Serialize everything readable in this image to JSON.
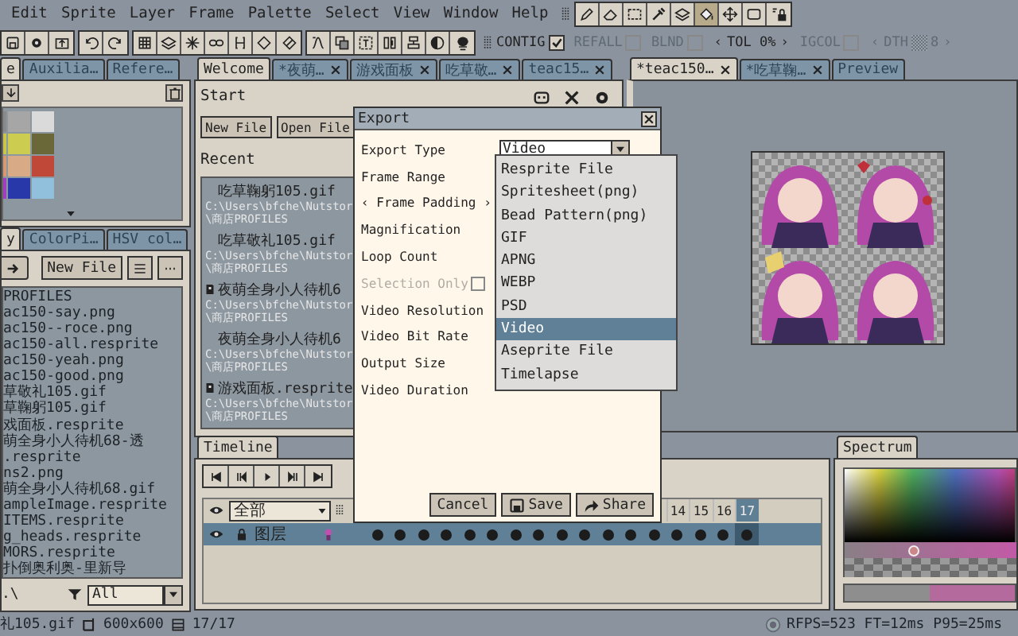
{
  "menu": [
    "Edit",
    "Sprite",
    "Layer",
    "Frame",
    "Palette",
    "Select",
    "View",
    "Window",
    "Help"
  ],
  "tools": [
    {
      "selected": false
    },
    {
      "selected": false
    },
    {
      "selected": false
    },
    {
      "selected": false
    },
    {
      "selected": false
    },
    {
      "selected": true
    },
    {
      "selected": false
    },
    {
      "selected": false
    },
    {
      "selected": false
    }
  ],
  "tool_options": [
    {
      "kind": "check",
      "label": "CONTIG",
      "checked": true,
      "disabled": false
    },
    {
      "kind": "check",
      "label": "REFALL",
      "checked": false,
      "disabled": true
    },
    {
      "kind": "check",
      "label": "BLND",
      "checked": false,
      "disabled": true
    },
    {
      "kind": "stepper",
      "left": "‹",
      "label": "TOL 0%",
      "right": "›",
      "disabled": false
    },
    {
      "kind": "check",
      "label": "IGCOL",
      "checked": false,
      "disabled": true
    },
    {
      "kind": "dither",
      "left": "‹",
      "label": "DTH",
      "value": "8",
      "right": "›",
      "disabled": true
    }
  ],
  "left_top_tabs": [
    {
      "label": "e",
      "selected": true
    },
    {
      "label": "Auxilia…",
      "selected": false
    },
    {
      "label": "Refere…",
      "selected": false
    }
  ],
  "palette": [
    {
      "color": "#8a8a8a"
    },
    {
      "color": "#a6a6a6"
    },
    {
      "color": "#dadada"
    },
    {
      "color": "#c8c848"
    },
    {
      "color": "#cccc50"
    },
    {
      "color": "#6a6838"
    },
    {
      "color": "#d89870"
    },
    {
      "color": "#d8aa86"
    },
    {
      "color": "#c04838"
    },
    {
      "color": "#a040c0"
    },
    {
      "color": "#2838a8"
    },
    {
      "color": "#90c0dc"
    }
  ],
  "left_bottom_tabs": [
    {
      "label": "y",
      "selected": true
    },
    {
      "label": "ColorPi…",
      "selected": false
    },
    {
      "label": "HSV col…",
      "selected": false
    }
  ],
  "files": {
    "new_button": "New File",
    "items": [
      "PROFILES",
      "ac150-say.png",
      "ac150--roce.png",
      "ac150-all.resprite",
      "ac150-yeah.png",
      "ac150-good.png",
      "草敬礼105.gif",
      "草鞠躬105.gif",
      "戏面板.resprite",
      "萌全身小人待机68-透",
      ".resprite",
      "ns2.png",
      "萌全身小人待机68.gif",
      "ampleImage.resprite",
      "ITEMS.resprite",
      "g_heads.resprite",
      "MORS.resprite",
      "扑倒奥利奥-里新导"
    ],
    "path": ".\\",
    "filter": "All"
  },
  "center_tabs": [
    {
      "label": "Welcome",
      "selected": true,
      "closable": false
    },
    {
      "label": "*夜萌…",
      "selected": false,
      "closable": true
    },
    {
      "label": "游戏面板",
      "selected": false,
      "closable": true
    },
    {
      "label": "吃草敬…",
      "selected": false,
      "closable": true
    },
    {
      "label": "teac15…",
      "selected": false,
      "closable": true
    }
  ],
  "welcome": {
    "start": "Start",
    "buttons": [
      "New File",
      "Open File"
    ],
    "recent_title": "Recent",
    "recent": [
      {
        "name": "吃草鞠躬105.gif",
        "kind": "gif",
        "path": [
          "C:\\Users\\bfche\\Nutstor",
          "\\商店PROFILES"
        ]
      },
      {
        "name": "吃草敬礼105.gif",
        "kind": "gif",
        "path": [
          "C:\\Users\\bfche\\Nutstor",
          "\\商店PROFILES"
        ]
      },
      {
        "name": "夜萌全身小人待机6",
        "kind": "resprite",
        "path": [
          "C:\\Users\\bfche\\Nutstor",
          "\\商店PROFILES"
        ]
      },
      {
        "name": "夜萌全身小人待机6",
        "kind": "gif",
        "path": [
          "C:\\Users\\bfche\\Nutstor",
          "\\商店PROFILES"
        ]
      },
      {
        "name": "游戏面板.resprite",
        "kind": "resprite",
        "path": [
          "C:\\Users\\bfche\\Nutstor",
          "\\商店PROFILES"
        ]
      }
    ]
  },
  "right_tabs": [
    {
      "label": "*teac150…",
      "selected": true,
      "closable": true
    },
    {
      "label": "*吃草鞠…",
      "selected": false,
      "closable": true
    },
    {
      "label": "Preview",
      "selected": false,
      "closable": false
    }
  ],
  "export": {
    "title": "Export",
    "type_label": "Export Type",
    "type_value": "Video",
    "rows": [
      {
        "kind": "text",
        "label": "Frame Range"
      },
      {
        "kind": "text",
        "label": "‹ Frame Padding ›"
      },
      {
        "kind": "text",
        "label": "Magnification"
      },
      {
        "kind": "text",
        "label": "Loop Count"
      },
      {
        "kind": "check",
        "label": "Selection Only",
        "checked": false,
        "disabled": true
      },
      {
        "kind": "text",
        "label": "Video Resolution"
      },
      {
        "kind": "text",
        "label": "Video Bit Rate"
      },
      {
        "kind": "text",
        "label": "Output Size"
      },
      {
        "kind": "text",
        "label": "Video Duration"
      }
    ],
    "options": [
      {
        "label": "Resprite File",
        "selected": false
      },
      {
        "label": "Spritesheet(png)",
        "selected": false
      },
      {
        "label": "Bead Pattern(png)",
        "selected": false
      },
      {
        "label": "GIF",
        "selected": false
      },
      {
        "label": "APNG",
        "selected": false
      },
      {
        "label": "WEBP",
        "selected": false
      },
      {
        "label": "PSD",
        "selected": false
      },
      {
        "label": "Video",
        "selected": true
      },
      {
        "label": "Aseprite File",
        "selected": false
      },
      {
        "label": "Timelapse",
        "selected": false
      }
    ],
    "buttons": [
      {
        "kind": "plain",
        "label": "Cancel"
      },
      {
        "kind": "save",
        "label": "Save"
      },
      {
        "kind": "share",
        "label": "Share"
      }
    ]
  },
  "timeline": {
    "tab": "Timeline",
    "filter": "全部",
    "frame_labels": [
      {
        "label": "14",
        "selected": false
      },
      {
        "label": "15",
        "selected": false
      },
      {
        "label": "16",
        "selected": false
      },
      {
        "label": "17",
        "selected": true
      }
    ],
    "layers": [
      {
        "name": "图层",
        "cels": [
          {
            "selected": false
          },
          {
            "selected": false
          },
          {
            "selected": false
          },
          {
            "selected": false
          },
          {
            "selected": false
          },
          {
            "selected": false
          },
          {
            "selected": false
          },
          {
            "selected": false
          },
          {
            "selected": false
          },
          {
            "selected": false
          },
          {
            "selected": false
          },
          {
            "selected": false
          },
          {
            "selected": false
          },
          {
            "selected": false
          },
          {
            "selected": false
          },
          {
            "selected": false
          },
          {
            "selected": true
          }
        ]
      }
    ]
  },
  "spectrum": {
    "tab": "Spectrum",
    "level": 0.4
  },
  "status": {
    "file": "礼105.gif",
    "size": "600x600",
    "frames": "17/17",
    "perf": "RFPS=523 FT=12ms P95=25ms"
  }
}
